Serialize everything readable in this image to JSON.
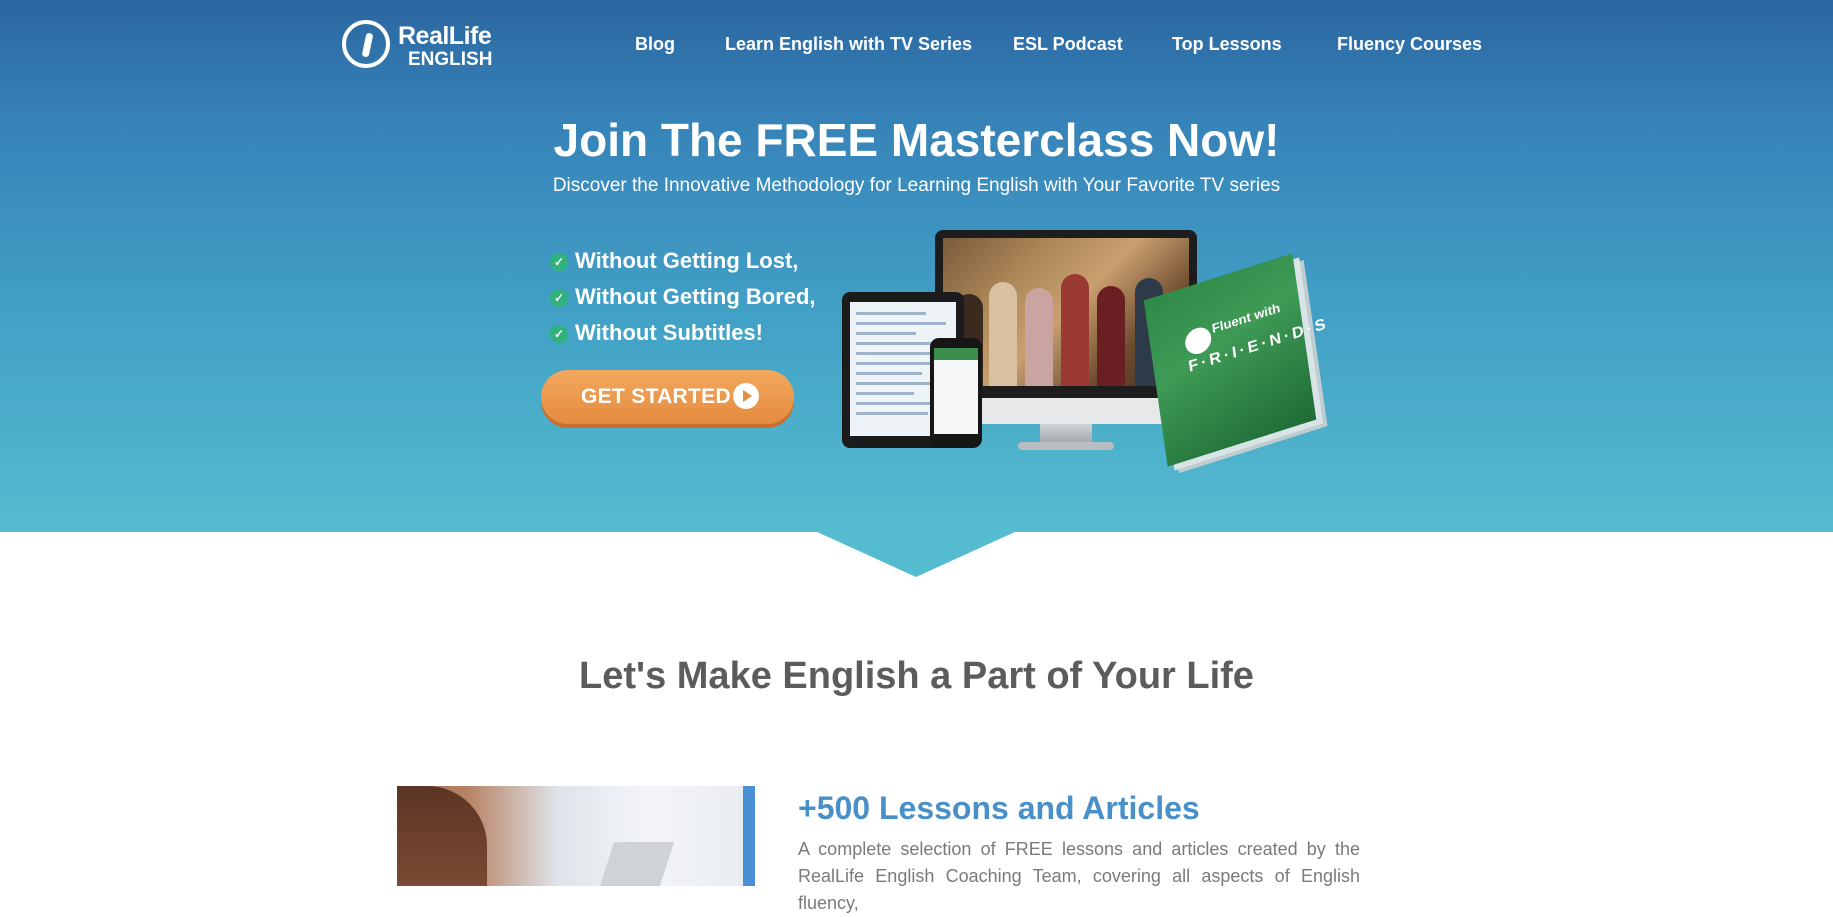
{
  "brand": {
    "line1": "RealLife",
    "line2": "ENGLISH"
  },
  "nav": {
    "items": [
      "Blog",
      "Learn English with TV Series",
      "ESL Podcast",
      "Top Lessons",
      "Fluency Courses"
    ]
  },
  "hero": {
    "title": "Join The FREE Masterclass Now!",
    "subtitle": "Discover the Innovative Methodology for Learning English with Your Favorite TV series",
    "bullets": [
      "Without Getting Lost,",
      "Without Getting Bored,",
      "Without Subtitles!"
    ],
    "cta_label": "GET STARTED",
    "book_title_1": "Fluent with",
    "book_title_2": "F·R·I·E·N·D·S"
  },
  "section": {
    "title": "Let's Make English a Part of Your Life",
    "feature_title": "+500 Lessons and Articles",
    "feature_desc": "A complete selection of FREE lessons and articles created by the RealLife English Coaching Team, covering all aspects of English fluency,"
  },
  "colors": {
    "hero_top": "#2b66a0",
    "hero_bottom": "#55bccf",
    "cta": "#e58b3f",
    "check": "#2fb37a",
    "feature_title": "#4a90c8"
  },
  "icons": [
    "logo-mark-icon",
    "check-icon",
    "play-circle-icon"
  ]
}
